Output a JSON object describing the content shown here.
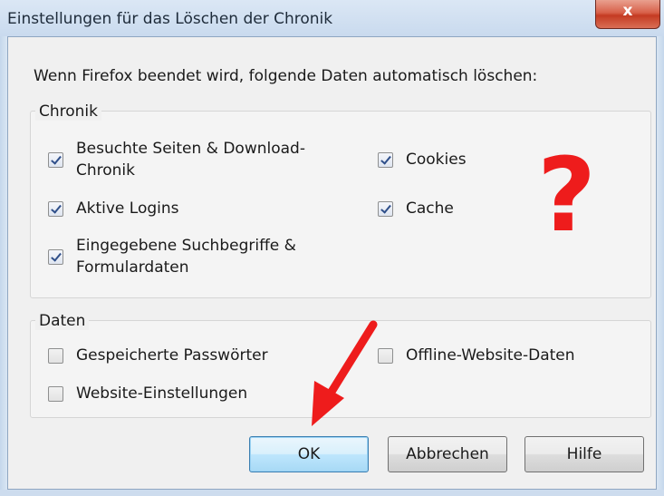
{
  "window": {
    "title": "Einstellungen für das Löschen der Chronik",
    "close_label": "x"
  },
  "intro_text": "Wenn Firefox beendet wird, folgende Daten automatisch löschen:",
  "chronik": {
    "label": "Chronik",
    "options": [
      {
        "label": "Besuchte Seiten & Download-\nChronik",
        "checked": true
      },
      {
        "label": "Cookies",
        "checked": true
      },
      {
        "label": "Aktive Logins",
        "checked": true
      },
      {
        "label": "Cache",
        "checked": true
      },
      {
        "label": "Eingegebene Suchbegriffe &\nFormulardaten",
        "checked": true
      }
    ]
  },
  "daten": {
    "label": "Daten",
    "options": [
      {
        "label": "Gespeicherte Passwörter",
        "checked": false
      },
      {
        "label": "Offline-Website-Daten",
        "checked": false
      },
      {
        "label": "Website-Einstellungen",
        "checked": false
      }
    ]
  },
  "buttons": {
    "ok": "OK",
    "cancel": "Abbrechen",
    "help": "Hilfe"
  },
  "annotation": {
    "question_mark": "?",
    "color": "#ee1c1c"
  },
  "colors": {
    "dialog_bg": "#f0f0f0",
    "checkbox_check": "#2f4f8a",
    "default_button_border": "#3c7fb1"
  }
}
